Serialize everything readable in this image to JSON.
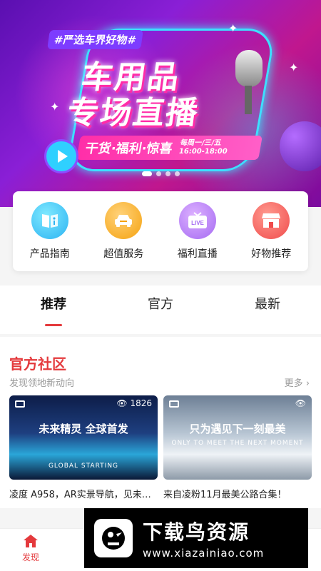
{
  "banner": {
    "tag": "#严选车界好物#",
    "title_line1": "车用品",
    "title_line2": "专场直播",
    "subtitle": "干货·福利·惊喜",
    "schedule_days": "每周一/三/五",
    "schedule_time": "16:00-18:00",
    "active_slide": 1,
    "slide_count": 4
  },
  "quick_actions": [
    {
      "label": "产品指南",
      "icon": "book-info-icon",
      "color": "#2cb3f2"
    },
    {
      "label": "超值服务",
      "icon": "car-icon",
      "color": "#f5a20f"
    },
    {
      "label": "福利直播",
      "icon": "live-tv-icon",
      "color": "#a56af2",
      "icon_text": "LIVE"
    },
    {
      "label": "好物推荐",
      "icon": "store-icon",
      "color": "#f04b4b"
    }
  ],
  "tabs": [
    {
      "label": "推荐",
      "active": true
    },
    {
      "label": "官方",
      "active": false
    },
    {
      "label": "最新",
      "active": false
    }
  ],
  "community": {
    "title": "官方社区",
    "subtitle": "发现领地新动向",
    "more": "更多",
    "cards": [
      {
        "views": "1826",
        "overlay": "未来精灵 全球首发",
        "overlay_en": "GLOBAL STARTING",
        "caption": "凌度 A958，AR实景导航，见未…"
      },
      {
        "views": "",
        "overlay": "只为遇见下一刻最美",
        "overlay_en": "ONLY TO MEET THE NEXT MOMENT",
        "caption": "来自凌粉11月最美公路合集！"
      }
    ]
  },
  "bottom_nav": {
    "label": "发现"
  },
  "watermark": {
    "title": "下载鸟资源",
    "url": "www.xiazainiao.com"
  },
  "colors": {
    "accent": "#e4393c"
  }
}
